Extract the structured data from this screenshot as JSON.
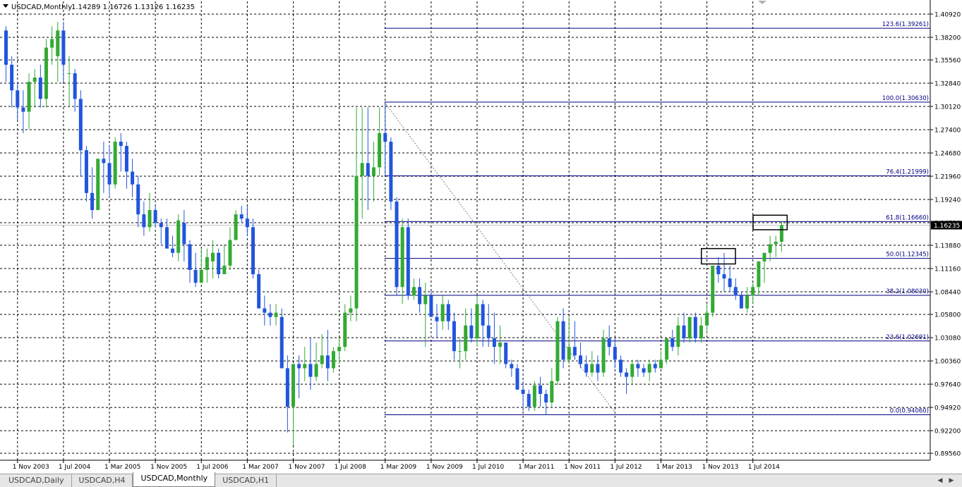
{
  "header": {
    "title": "USDCAD,Monthly",
    "ohlc": "1.14289 1.16726 1.13126 1.16235",
    "dropdown_icon": "triangle-down-icon"
  },
  "colors": {
    "bull": "#33aa33",
    "bear": "#2255dd",
    "grid": "#000000",
    "fib": "#000080",
    "price_marker_bg": "#000000",
    "price_marker_text": "#ffffff"
  },
  "tabs": [
    {
      "label": "USDCAD,Daily",
      "active": false
    },
    {
      "label": "USDCAD,H4",
      "active": false
    },
    {
      "label": "USDCAD,Monthly",
      "active": true
    },
    {
      "label": "USDCAD,H1",
      "active": false
    }
  ],
  "tab_scroll_icons": [
    "arrow-left-icon",
    "arrow-right-icon"
  ],
  "chart_data": {
    "type": "candlestick",
    "symbol": "USDCAD",
    "timeframe": "Monthly",
    "current_price": "1.16235",
    "y_axis_ticks": [
      "1.40920",
      "1.38200",
      "1.35560",
      "1.32840",
      "1.30120",
      "1.27400",
      "1.24680",
      "1.21960",
      "1.19240",
      "1.16520",
      "1.13880",
      "1.11160",
      "1.08440",
      "1.05800",
      "1.03080",
      "1.00360",
      "0.97640",
      "0.94920",
      "0.92200",
      "0.89560"
    ],
    "x_axis_ticks": [
      "1 Nov 2003",
      "1 Jul 2004",
      "1 Mar 2005",
      "1 Nov 2005",
      "1 Jul 2006",
      "1 Mar 2007",
      "1 Nov 2007",
      "1 Jul 2008",
      "1 Mar 2009",
      "1 Nov 2009",
      "1 Jul 2010",
      "1 Mar 2011",
      "1 Nov 2011",
      "1 Jul 2012",
      "1 Mar 2013",
      "1 Nov 2013",
      "1 Jul 2014"
    ],
    "fib_levels": [
      {
        "label": "123.6(1.39261)",
        "value": 1.39261
      },
      {
        "label": "100.0(1.30630)",
        "value": 1.3063
      },
      {
        "label": "76.4(1.21999)",
        "value": 1.21999
      },
      {
        "label": "61.8(1.16660)",
        "value": 1.1666
      },
      {
        "label": "50.0(1.12345)",
        "value": 1.12345
      },
      {
        "label": "38.2(1.08030)",
        "value": 1.0803
      },
      {
        "label": "23.6(1.02691)",
        "value": 1.02691
      },
      {
        "label": "0.0(0.94060)",
        "value": 0.9406
      }
    ],
    "fib_anchor": {
      "high_date": "2009-03",
      "high": 1.3063,
      "low_date": "2011-07",
      "low": 0.9406
    },
    "highlight_boxes": [
      {
        "date_from": "2013-12",
        "date_to": "2014-02",
        "low": 1.117,
        "high": 1.135
      },
      {
        "date_from": "2014-09",
        "date_to": "2014-11",
        "low": 1.157,
        "high": 1.174
      }
    ],
    "ylim": [
      0.8935,
      1.4135
    ],
    "grid": true,
    "candles": [
      {
        "d": "2003-09",
        "o": 1.39,
        "h": 1.395,
        "l": 1.33,
        "c": 1.35
      },
      {
        "d": "2003-10",
        "o": 1.35,
        "h": 1.36,
        "l": 1.3,
        "c": 1.32
      },
      {
        "d": "2003-11",
        "o": 1.32,
        "h": 1.33,
        "l": 1.285,
        "c": 1.3
      },
      {
        "d": "2003-12",
        "o": 1.3,
        "h": 1.32,
        "l": 1.27,
        "c": 1.295
      },
      {
        "d": "2004-01",
        "o": 1.295,
        "h": 1.34,
        "l": 1.275,
        "c": 1.33
      },
      {
        "d": "2004-02",
        "o": 1.33,
        "h": 1.345,
        "l": 1.3,
        "c": 1.335
      },
      {
        "d": "2004-03",
        "o": 1.335,
        "h": 1.35,
        "l": 1.3,
        "c": 1.31
      },
      {
        "d": "2004-04",
        "o": 1.31,
        "h": 1.38,
        "l": 1.3,
        "c": 1.37
      },
      {
        "d": "2004-05",
        "o": 1.37,
        "h": 1.395,
        "l": 1.35,
        "c": 1.38
      },
      {
        "d": "2004-06",
        "o": 1.36,
        "h": 1.4,
        "l": 1.33,
        "c": 1.39
      },
      {
        "d": "2004-07",
        "o": 1.39,
        "h": 1.4,
        "l": 1.33,
        "c": 1.35
      },
      {
        "d": "2004-08",
        "o": 1.34,
        "h": 1.36,
        "l": 1.3,
        "c": 1.34
      },
      {
        "d": "2004-09",
        "o": 1.34,
        "h": 1.345,
        "l": 1.295,
        "c": 1.31
      },
      {
        "d": "2004-10",
        "o": 1.31,
        "h": 1.32,
        "l": 1.22,
        "c": 1.25
      },
      {
        "d": "2004-11",
        "o": 1.25,
        "h": 1.255,
        "l": 1.19,
        "c": 1.2
      },
      {
        "d": "2004-12",
        "o": 1.2,
        "h": 1.23,
        "l": 1.17,
        "c": 1.18
      },
      {
        "d": "2005-01",
        "o": 1.18,
        "h": 1.24,
        "l": 1.18,
        "c": 1.24
      },
      {
        "d": "2005-02",
        "o": 1.24,
        "h": 1.26,
        "l": 1.2,
        "c": 1.235
      },
      {
        "d": "2005-03",
        "o": 1.235,
        "h": 1.255,
        "l": 1.195,
        "c": 1.21
      },
      {
        "d": "2005-04",
        "o": 1.21,
        "h": 1.265,
        "l": 1.205,
        "c": 1.26
      },
      {
        "d": "2005-05",
        "o": 1.26,
        "h": 1.27,
        "l": 1.225,
        "c": 1.255
      },
      {
        "d": "2005-06",
        "o": 1.255,
        "h": 1.26,
        "l": 1.205,
        "c": 1.225
      },
      {
        "d": "2005-07",
        "o": 1.225,
        "h": 1.24,
        "l": 1.195,
        "c": 1.21
      },
      {
        "d": "2005-08",
        "o": 1.21,
        "h": 1.22,
        "l": 1.16,
        "c": 1.175
      },
      {
        "d": "2005-09",
        "o": 1.175,
        "h": 1.19,
        "l": 1.15,
        "c": 1.16
      },
      {
        "d": "2005-10",
        "o": 1.16,
        "h": 1.2,
        "l": 1.155,
        "c": 1.18
      },
      {
        "d": "2005-11",
        "o": 1.18,
        "h": 1.185,
        "l": 1.16,
        "c": 1.165
      },
      {
        "d": "2005-12",
        "o": 1.165,
        "h": 1.17,
        "l": 1.14,
        "c": 1.16
      },
      {
        "d": "2006-01",
        "o": 1.16,
        "h": 1.17,
        "l": 1.135,
        "c": 1.135
      },
      {
        "d": "2006-02",
        "o": 1.135,
        "h": 1.15,
        "l": 1.125,
        "c": 1.13
      },
      {
        "d": "2006-03",
        "o": 1.13,
        "h": 1.175,
        "l": 1.12,
        "c": 1.168
      },
      {
        "d": "2006-04",
        "o": 1.165,
        "h": 1.18,
        "l": 1.12,
        "c": 1.14
      },
      {
        "d": "2006-05",
        "o": 1.14,
        "h": 1.145,
        "l": 1.095,
        "c": 1.11
      },
      {
        "d": "2006-06",
        "o": 1.11,
        "h": 1.13,
        "l": 1.09,
        "c": 1.095
      },
      {
        "d": "2006-07",
        "o": 1.095,
        "h": 1.135,
        "l": 1.095,
        "c": 1.11
      },
      {
        "d": "2006-08",
        "o": 1.11,
        "h": 1.135,
        "l": 1.095,
        "c": 1.125
      },
      {
        "d": "2006-09",
        "o": 1.12,
        "h": 1.145,
        "l": 1.1,
        "c": 1.13
      },
      {
        "d": "2006-10",
        "o": 1.13,
        "h": 1.135,
        "l": 1.1,
        "c": 1.105
      },
      {
        "d": "2006-11",
        "o": 1.105,
        "h": 1.14,
        "l": 1.105,
        "c": 1.115
      },
      {
        "d": "2006-12",
        "o": 1.115,
        "h": 1.16,
        "l": 1.11,
        "c": 1.145
      },
      {
        "d": "2007-01",
        "o": 1.145,
        "h": 1.18,
        "l": 1.145,
        "c": 1.175
      },
      {
        "d": "2007-02",
        "o": 1.175,
        "h": 1.185,
        "l": 1.165,
        "c": 1.17
      },
      {
        "d": "2007-03",
        "o": 1.17,
        "h": 1.185,
        "l": 1.15,
        "c": 1.16
      },
      {
        "d": "2007-04",
        "o": 1.16,
        "h": 1.17,
        "l": 1.1,
        "c": 1.105
      },
      {
        "d": "2007-05",
        "o": 1.105,
        "h": 1.11,
        "l": 1.065,
        "c": 1.065
      },
      {
        "d": "2007-06",
        "o": 1.065,
        "h": 1.08,
        "l": 1.045,
        "c": 1.06
      },
      {
        "d": "2007-07",
        "o": 1.06,
        "h": 1.07,
        "l": 1.045,
        "c": 1.055
      },
      {
        "d": "2007-08",
        "o": 1.055,
        "h": 1.07,
        "l": 1.045,
        "c": 1.06
      },
      {
        "d": "2007-09",
        "o": 1.055,
        "h": 1.065,
        "l": 0.995,
        "c": 0.995
      },
      {
        "d": "2007-10",
        "o": 0.995,
        "h": 1.01,
        "l": 0.92,
        "c": 0.95
      },
      {
        "d": "2007-11",
        "o": 0.95,
        "h": 1.0,
        "l": 0.905,
        "c": 1.0
      },
      {
        "d": "2007-12",
        "o": 1.0,
        "h": 1.01,
        "l": 0.96,
        "c": 0.995
      },
      {
        "d": "2008-01",
        "o": 0.995,
        "h": 1.02,
        "l": 0.98,
        "c": 1.0
      },
      {
        "d": "2008-02",
        "o": 1.0,
        "h": 1.03,
        "l": 0.97,
        "c": 0.985
      },
      {
        "d": "2008-03",
        "o": 0.985,
        "h": 1.025,
        "l": 0.98,
        "c": 1.0
      },
      {
        "d": "2008-04",
        "o": 1.0,
        "h": 1.035,
        "l": 0.995,
        "c": 1.01
      },
      {
        "d": "2008-05",
        "o": 1.01,
        "h": 1.04,
        "l": 0.98,
        "c": 0.995
      },
      {
        "d": "2008-06",
        "o": 0.995,
        "h": 1.02,
        "l": 0.99,
        "c": 1.015
      },
      {
        "d": "2008-07",
        "o": 1.015,
        "h": 1.03,
        "l": 1.0,
        "c": 1.02
      },
      {
        "d": "2008-08",
        "o": 1.02,
        "h": 1.07,
        "l": 1.015,
        "c": 1.06
      },
      {
        "d": "2008-09",
        "o": 1.06,
        "h": 1.08,
        "l": 1.05,
        "c": 1.065
      },
      {
        "d": "2008-10",
        "o": 1.065,
        "h": 1.3,
        "l": 1.05,
        "c": 1.22
      },
      {
        "d": "2008-11",
        "o": 1.22,
        "h": 1.3,
        "l": 1.17,
        "c": 1.235
      },
      {
        "d": "2008-12",
        "o": 1.235,
        "h": 1.3,
        "l": 1.18,
        "c": 1.22
      },
      {
        "d": "2009-01",
        "o": 1.22,
        "h": 1.26,
        "l": 1.19,
        "c": 1.23
      },
      {
        "d": "2009-02",
        "o": 1.23,
        "h": 1.3,
        "l": 1.22,
        "c": 1.27
      },
      {
        "d": "2009-03",
        "o": 1.27,
        "h": 1.3063,
        "l": 1.22,
        "c": 1.26
      },
      {
        "d": "2009-04",
        "o": 1.26,
        "h": 1.265,
        "l": 1.18,
        "c": 1.19
      },
      {
        "d": "2009-05",
        "o": 1.19,
        "h": 1.195,
        "l": 1.08,
        "c": 1.09
      },
      {
        "d": "2009-06",
        "o": 1.09,
        "h": 1.17,
        "l": 1.07,
        "c": 1.16
      },
      {
        "d": "2009-07",
        "o": 1.16,
        "h": 1.17,
        "l": 1.075,
        "c": 1.08
      },
      {
        "d": "2009-08",
        "o": 1.08,
        "h": 1.1,
        "l": 1.075,
        "c": 1.09
      },
      {
        "d": "2009-09",
        "o": 1.09,
        "h": 1.1,
        "l": 1.06,
        "c": 1.07
      },
      {
        "d": "2009-10",
        "o": 1.07,
        "h": 1.095,
        "l": 1.02,
        "c": 1.08
      },
      {
        "d": "2009-11",
        "o": 1.08,
        "h": 1.085,
        "l": 1.055,
        "c": 1.055
      },
      {
        "d": "2009-12",
        "o": 1.055,
        "h": 1.07,
        "l": 1.03,
        "c": 1.05
      },
      {
        "d": "2010-01",
        "o": 1.05,
        "h": 1.08,
        "l": 1.04,
        "c": 1.07
      },
      {
        "d": "2010-02",
        "o": 1.07,
        "h": 1.075,
        "l": 1.04,
        "c": 1.05
      },
      {
        "d": "2010-03",
        "o": 1.05,
        "h": 1.06,
        "l": 1.005,
        "c": 1.015
      },
      {
        "d": "2010-04",
        "o": 1.015,
        "h": 1.03,
        "l": 0.995,
        "c": 1.015
      },
      {
        "d": "2010-05",
        "o": 1.015,
        "h": 1.065,
        "l": 1.005,
        "c": 1.045
      },
      {
        "d": "2010-06",
        "o": 1.045,
        "h": 1.065,
        "l": 1.025,
        "c": 1.03
      },
      {
        "d": "2010-07",
        "o": 1.03,
        "h": 1.08,
        "l": 1.02,
        "c": 1.07
      },
      {
        "d": "2010-08",
        "o": 1.07,
        "h": 1.075,
        "l": 1.02,
        "c": 1.045
      },
      {
        "d": "2010-09",
        "o": 1.045,
        "h": 1.07,
        "l": 1.02,
        "c": 1.03
      },
      {
        "d": "2010-10",
        "o": 1.03,
        "h": 1.06,
        "l": 1.0,
        "c": 1.02
      },
      {
        "d": "2010-11",
        "o": 1.02,
        "h": 1.045,
        "l": 1.0,
        "c": 1.025
      },
      {
        "d": "2010-12",
        "o": 1.025,
        "h": 1.025,
        "l": 0.995,
        "c": 1.0
      },
      {
        "d": "2011-01",
        "o": 1.0,
        "h": 1.005,
        "l": 0.985,
        "c": 0.995
      },
      {
        "d": "2011-02",
        "o": 0.995,
        "h": 1.0,
        "l": 0.97,
        "c": 0.97
      },
      {
        "d": "2011-03",
        "o": 0.97,
        "h": 0.98,
        "l": 0.945,
        "c": 0.965
      },
      {
        "d": "2011-04",
        "o": 0.965,
        "h": 0.97,
        "l": 0.945,
        "c": 0.95
      },
      {
        "d": "2011-05",
        "o": 0.95,
        "h": 0.98,
        "l": 0.945,
        "c": 0.975
      },
      {
        "d": "2011-06",
        "o": 0.975,
        "h": 0.985,
        "l": 0.95,
        "c": 0.965
      },
      {
        "d": "2011-07",
        "o": 0.965,
        "h": 0.97,
        "l": 0.9406,
        "c": 0.955
      },
      {
        "d": "2011-08",
        "o": 0.955,
        "h": 0.995,
        "l": 0.95,
        "c": 0.98
      },
      {
        "d": "2011-09",
        "o": 0.98,
        "h": 1.055,
        "l": 0.975,
        "c": 1.05
      },
      {
        "d": "2011-10",
        "o": 1.05,
        "h": 1.065,
        "l": 0.995,
        "c": 1.005
      },
      {
        "d": "2011-11",
        "o": 1.005,
        "h": 1.055,
        "l": 1.0,
        "c": 1.02
      },
      {
        "d": "2011-12",
        "o": 1.02,
        "h": 1.05,
        "l": 1.005,
        "c": 1.01
      },
      {
        "d": "2012-01",
        "o": 1.01,
        "h": 1.025,
        "l": 0.995,
        "c": 1.0
      },
      {
        "d": "2012-02",
        "o": 1.0,
        "h": 1.01,
        "l": 0.985,
        "c": 0.99
      },
      {
        "d": "2012-03",
        "o": 0.99,
        "h": 1.015,
        "l": 0.985,
        "c": 1.0
      },
      {
        "d": "2012-04",
        "o": 1.0,
        "h": 1.01,
        "l": 0.98,
        "c": 0.99
      },
      {
        "d": "2012-05",
        "o": 0.99,
        "h": 1.04,
        "l": 0.985,
        "c": 1.03
      },
      {
        "d": "2012-06",
        "o": 1.03,
        "h": 1.045,
        "l": 1.01,
        "c": 1.02
      },
      {
        "d": "2012-07",
        "o": 1.02,
        "h": 1.03,
        "l": 0.995,
        "c": 1.005
      },
      {
        "d": "2012-08",
        "o": 1.005,
        "h": 1.01,
        "l": 0.985,
        "c": 0.99
      },
      {
        "d": "2012-09",
        "o": 0.99,
        "h": 0.995,
        "l": 0.965,
        "c": 0.985
      },
      {
        "d": "2012-10",
        "o": 0.985,
        "h": 1.005,
        "l": 0.975,
        "c": 1.0
      },
      {
        "d": "2012-11",
        "o": 1.0,
        "h": 1.005,
        "l": 0.985,
        "c": 0.995
      },
      {
        "d": "2012-12",
        "o": 0.995,
        "h": 1.0,
        "l": 0.985,
        "c": 0.99
      },
      {
        "d": "2013-01",
        "o": 0.99,
        "h": 1.005,
        "l": 0.98,
        "c": 1.0
      },
      {
        "d": "2013-02",
        "o": 1.0,
        "h": 1.005,
        "l": 0.99,
        "c": 0.995
      },
      {
        "d": "2013-03",
        "o": 0.995,
        "h": 1.015,
        "l": 0.995,
        "c": 1.005
      },
      {
        "d": "2013-04",
        "o": 1.005,
        "h": 1.03,
        "l": 1.0,
        "c": 1.03
      },
      {
        "d": "2013-05",
        "o": 1.03,
        "h": 1.04,
        "l": 1.015,
        "c": 1.02
      },
      {
        "d": "2013-06",
        "o": 1.02,
        "h": 1.055,
        "l": 1.01,
        "c": 1.045
      },
      {
        "d": "2013-07",
        "o": 1.045,
        "h": 1.06,
        "l": 1.025,
        "c": 1.03
      },
      {
        "d": "2013-08",
        "o": 1.03,
        "h": 1.055,
        "l": 1.025,
        "c": 1.055
      },
      {
        "d": "2013-09",
        "o": 1.055,
        "h": 1.06,
        "l": 1.025,
        "c": 1.03
      },
      {
        "d": "2013-10",
        "o": 1.03,
        "h": 1.055,
        "l": 1.025,
        "c": 1.045
      },
      {
        "d": "2013-11",
        "o": 1.045,
        "h": 1.07,
        "l": 1.035,
        "c": 1.06
      },
      {
        "d": "2013-12",
        "o": 1.06,
        "h": 1.115,
        "l": 1.055,
        "c": 1.115
      },
      {
        "d": "2014-01",
        "o": 1.115,
        "h": 1.125,
        "l": 1.095,
        "c": 1.105
      },
      {
        "d": "2014-02",
        "o": 1.105,
        "h": 1.13,
        "l": 1.085,
        "c": 1.1
      },
      {
        "d": "2014-03",
        "o": 1.1,
        "h": 1.115,
        "l": 1.085,
        "c": 1.09
      },
      {
        "d": "2014-04",
        "o": 1.09,
        "h": 1.1,
        "l": 1.075,
        "c": 1.08
      },
      {
        "d": "2014-05",
        "o": 1.08,
        "h": 1.085,
        "l": 1.065,
        "c": 1.065
      },
      {
        "d": "2014-06",
        "o": 1.065,
        "h": 1.09,
        "l": 1.06,
        "c": 1.08
      },
      {
        "d": "2014-07",
        "o": 1.08,
        "h": 1.095,
        "l": 1.07,
        "c": 1.09
      },
      {
        "d": "2014-08",
        "o": 1.09,
        "h": 1.12,
        "l": 1.08,
        "c": 1.12
      },
      {
        "d": "2014-09",
        "o": 1.12,
        "h": 1.13,
        "l": 1.095,
        "c": 1.13
      },
      {
        "d": "2014-10",
        "o": 1.13,
        "h": 1.15,
        "l": 1.12,
        "c": 1.14
      },
      {
        "d": "2014-11",
        "o": 1.14,
        "h": 1.15,
        "l": 1.125,
        "c": 1.143
      },
      {
        "d": "2014-12",
        "o": 1.1429,
        "h": 1.1673,
        "l": 1.1313,
        "c": 1.16235
      }
    ]
  }
}
